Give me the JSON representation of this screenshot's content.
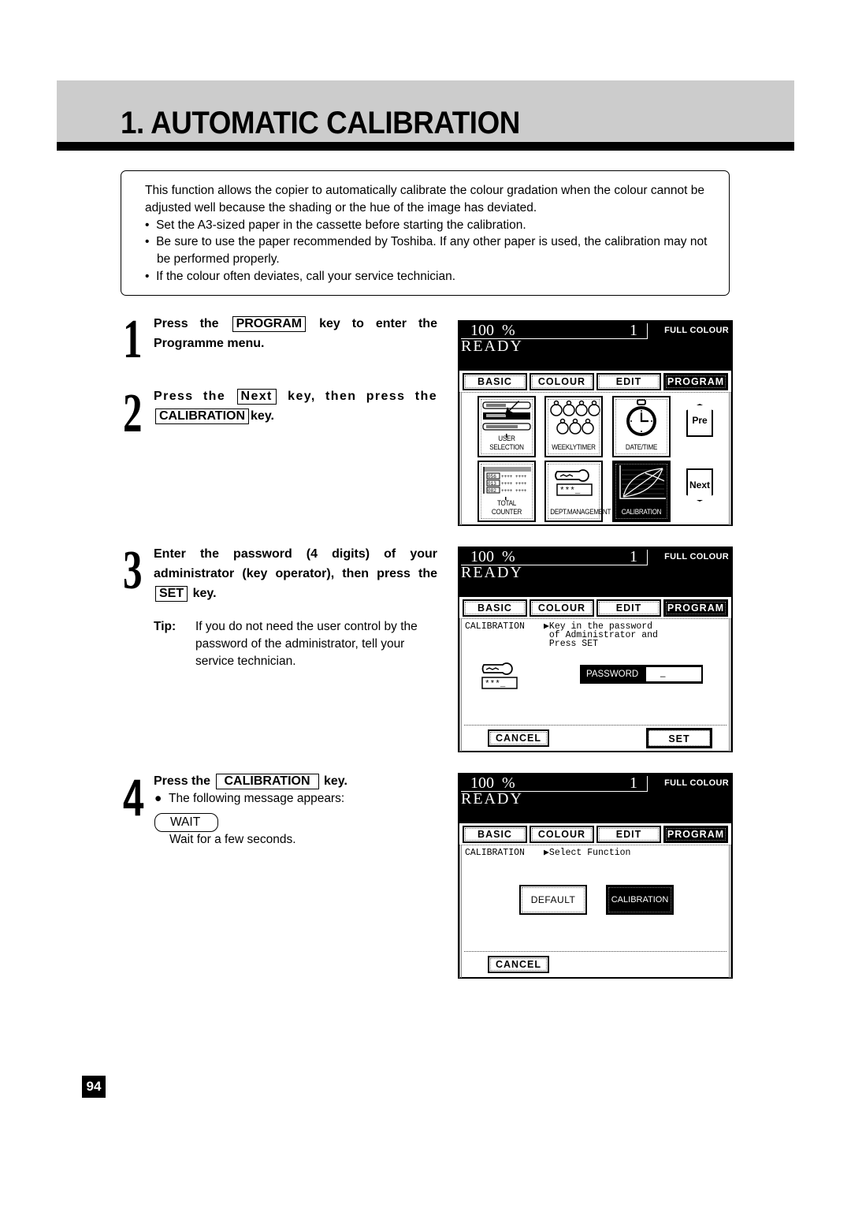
{
  "page": {
    "title": "1. AUTOMATIC CALIBRATION",
    "page_number": "94"
  },
  "intro": {
    "paragraph": "This function allows the copier to automatically calibrate the colour gradation when the colour cannot be adjusted well because the shading or the hue of the image has deviated.",
    "bullets": [
      "Set the A3-sized paper in the cassette before starting the calibration.",
      "Be sure to use the paper recommended by Toshiba. If any other paper is used, the calibration may not be performed properly.",
      "If the colour often deviates, call your service technician."
    ],
    "bullet_char": "•"
  },
  "steps": [
    {
      "number": "1",
      "pre": "Press the",
      "key": "PROGRAM",
      "post": "key to enter the Programme menu."
    },
    {
      "number": "2",
      "pre": "Press the",
      "key": "Next",
      "mid": "key, then press the",
      "key2": "CALIBRATION",
      "post": "key."
    },
    {
      "number": "3",
      "pre": "Enter the password (4 digits) of your administrator (key operator), then press the",
      "key": "SET",
      "post": "key."
    },
    {
      "number": "4",
      "pre": "Press the",
      "key": "CALIBRATION",
      "post": "key."
    }
  ],
  "tip": {
    "label": "Tip:",
    "text": "If you do not need the user control by the password of the administrator, tell your service technician."
  },
  "step4": {
    "bullet": "●",
    "message_intro": "The following message appears:",
    "message": "WAIT",
    "note": "Wait for a few seconds."
  },
  "lcd": {
    "zoom": "100  %",
    "count": "1",
    "mode": "FULL COLOUR",
    "status": "READY",
    "tabs": [
      "BASIC",
      "COLOUR",
      "EDIT",
      "PROGRAM"
    ],
    "active_tab": "PROGRAM"
  },
  "panel1": {
    "tiles": [
      {
        "label": "USER SELECTION",
        "icon": "user-selection-icon"
      },
      {
        "label": "WEEKLYTIMER",
        "icon": "stopwatch-group-icon"
      },
      {
        "label": "DATE/TIME",
        "icon": "stopwatch-icon"
      },
      {
        "label": "TOTAL COUNTER",
        "icon": "counter-table-icon"
      },
      {
        "label": "DEPT.MANAGEMENT",
        "icon": "key-icon"
      },
      {
        "label": "CALIBRATION",
        "icon": "calibration-graph-icon",
        "active": true
      }
    ],
    "pre_label": "Pre",
    "next_label": "Next",
    "counter_codes": [
      "056",
      "013",
      "082"
    ],
    "masked": "***_"
  },
  "panel2": {
    "section": "CALIBRATION",
    "prompt_lines": [
      "▶Key in the password",
      " of Administrator and",
      " Press SET"
    ],
    "masked": "***_",
    "password_label": "PASSWORD",
    "password_value": "_",
    "cancel_label": "CANCEL",
    "set_label": "SET"
  },
  "panel3": {
    "section": "CALIBRATION",
    "prompt": "▶Select Function",
    "default_label": "DEFAULT",
    "calibration_label": "CALIBRATION",
    "cancel_label": "CANCEL"
  }
}
